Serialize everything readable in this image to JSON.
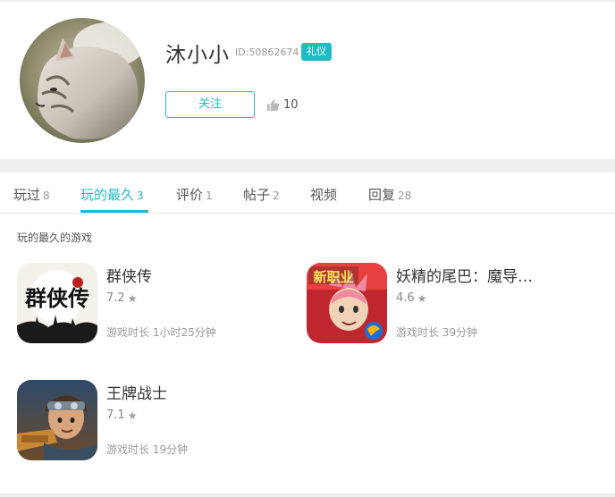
{
  "profile": {
    "username": "沐小小",
    "user_id": "ID:50862674",
    "badge": "礼仪",
    "follow_label": "关注",
    "like_count": "10",
    "like_icon": "thumbs-up-icon"
  },
  "tabs": [
    {
      "label": "玩过",
      "count": "8"
    },
    {
      "label": "玩的最久",
      "count": "3"
    },
    {
      "label": "评价",
      "count": "1"
    },
    {
      "label": "帖子",
      "count": "2"
    },
    {
      "label": "视频",
      "count": ""
    },
    {
      "label": "回复",
      "count": "28"
    }
  ],
  "active_tab": "玩的最久",
  "section_title": "玩的最久的游戏",
  "games": [
    {
      "name": "群侠传",
      "rating": "7.2",
      "time": "游戏时长 1小时25分钟",
      "icon_text": "群侠传"
    },
    {
      "name": "妖精的尾巴：魔导少年",
      "display_name": "妖精的尾巴：魔导…",
      "rating": "4.6",
      "time": "游戏时长 39分钟",
      "icon_text": "新职业"
    },
    {
      "name": "王牌战士",
      "rating": "7.1",
      "time": "游戏时长 19分钟"
    }
  ],
  "colors": {
    "accent": "#1fbcc5",
    "background": "#efefef"
  }
}
